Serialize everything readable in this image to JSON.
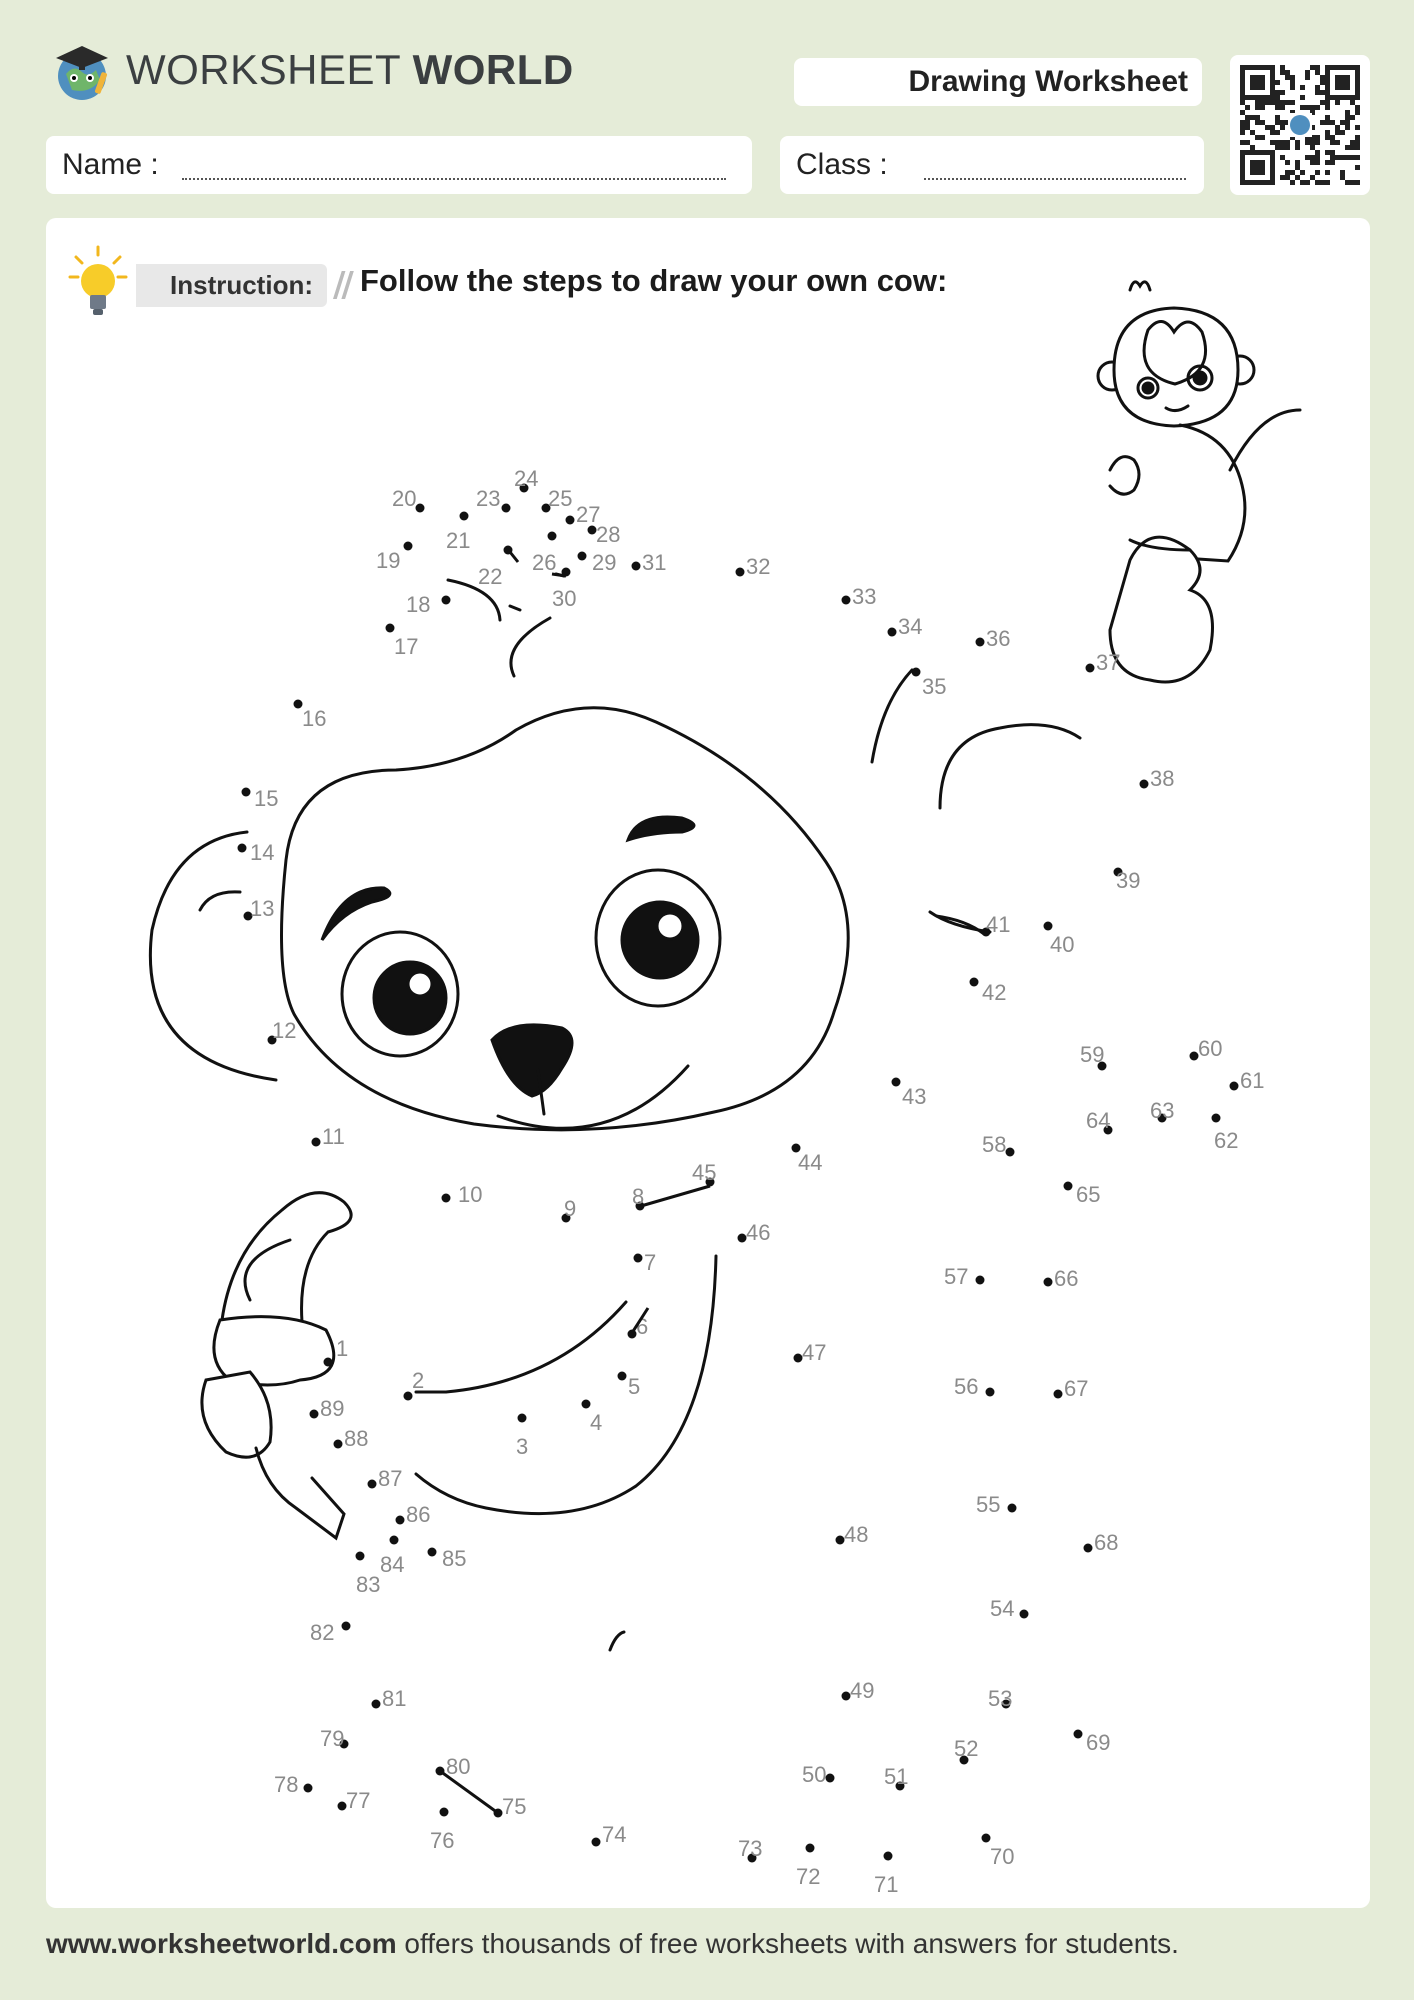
{
  "header": {
    "brand_part1": "WORKSHEET",
    "brand_part2": "WORLD",
    "worksheet_type": "Drawing Worksheet"
  },
  "fields": {
    "name_label": "Name :",
    "class_label": "Class :"
  },
  "instruction": {
    "badge": "Instruction:",
    "text": "Follow the steps to draw your own cow:"
  },
  "footer": {
    "site": "www.worksheetworld.com",
    "text": " offers thousands of free worksheets with answers for students."
  },
  "dots": [
    {
      "n": "1"
    },
    {
      "n": "2"
    },
    {
      "n": "3"
    },
    {
      "n": "4"
    },
    {
      "n": "5"
    },
    {
      "n": "6"
    },
    {
      "n": "7"
    },
    {
      "n": "8"
    },
    {
      "n": "9"
    },
    {
      "n": "10"
    },
    {
      "n": "11"
    },
    {
      "n": "12"
    },
    {
      "n": "13"
    },
    {
      "n": "14"
    },
    {
      "n": "15"
    },
    {
      "n": "16"
    },
    {
      "n": "17"
    },
    {
      "n": "18"
    },
    {
      "n": "19"
    },
    {
      "n": "20"
    },
    {
      "n": "21"
    },
    {
      "n": "22"
    },
    {
      "n": "23"
    },
    {
      "n": "24"
    },
    {
      "n": "25"
    },
    {
      "n": "26"
    },
    {
      "n": "27"
    },
    {
      "n": "28"
    },
    {
      "n": "29"
    },
    {
      "n": "30"
    },
    {
      "n": "31"
    },
    {
      "n": "32"
    },
    {
      "n": "33"
    },
    {
      "n": "34"
    },
    {
      "n": "35"
    },
    {
      "n": "36"
    },
    {
      "n": "37"
    },
    {
      "n": "38"
    },
    {
      "n": "39"
    },
    {
      "n": "40"
    },
    {
      "n": "41"
    },
    {
      "n": "42"
    },
    {
      "n": "43"
    },
    {
      "n": "44"
    },
    {
      "n": "45"
    },
    {
      "n": "46"
    },
    {
      "n": "47"
    },
    {
      "n": "48"
    },
    {
      "n": "49"
    },
    {
      "n": "50"
    },
    {
      "n": "51"
    },
    {
      "n": "52"
    },
    {
      "n": "53"
    },
    {
      "n": "54"
    },
    {
      "n": "55"
    },
    {
      "n": "56"
    },
    {
      "n": "57"
    },
    {
      "n": "58"
    },
    {
      "n": "59"
    },
    {
      "n": "60"
    },
    {
      "n": "61"
    },
    {
      "n": "62"
    },
    {
      "n": "63"
    },
    {
      "n": "64"
    },
    {
      "n": "65"
    },
    {
      "n": "66"
    },
    {
      "n": "67"
    },
    {
      "n": "68"
    },
    {
      "n": "69"
    },
    {
      "n": "70"
    },
    {
      "n": "71"
    },
    {
      "n": "72"
    },
    {
      "n": "73"
    },
    {
      "n": "74"
    },
    {
      "n": "75"
    },
    {
      "n": "76"
    },
    {
      "n": "77"
    },
    {
      "n": "78"
    },
    {
      "n": "79"
    },
    {
      "n": "80"
    },
    {
      "n": "81"
    },
    {
      "n": "82"
    },
    {
      "n": "83"
    },
    {
      "n": "84"
    },
    {
      "n": "85"
    },
    {
      "n": "86"
    },
    {
      "n": "87"
    },
    {
      "n": "88"
    },
    {
      "n": "89"
    }
  ],
  "colors": {
    "page_bg": "#e5ecd8",
    "panel_bg": "#ffffff",
    "ink": "#111111",
    "label_gray": "#8a8a8a"
  }
}
